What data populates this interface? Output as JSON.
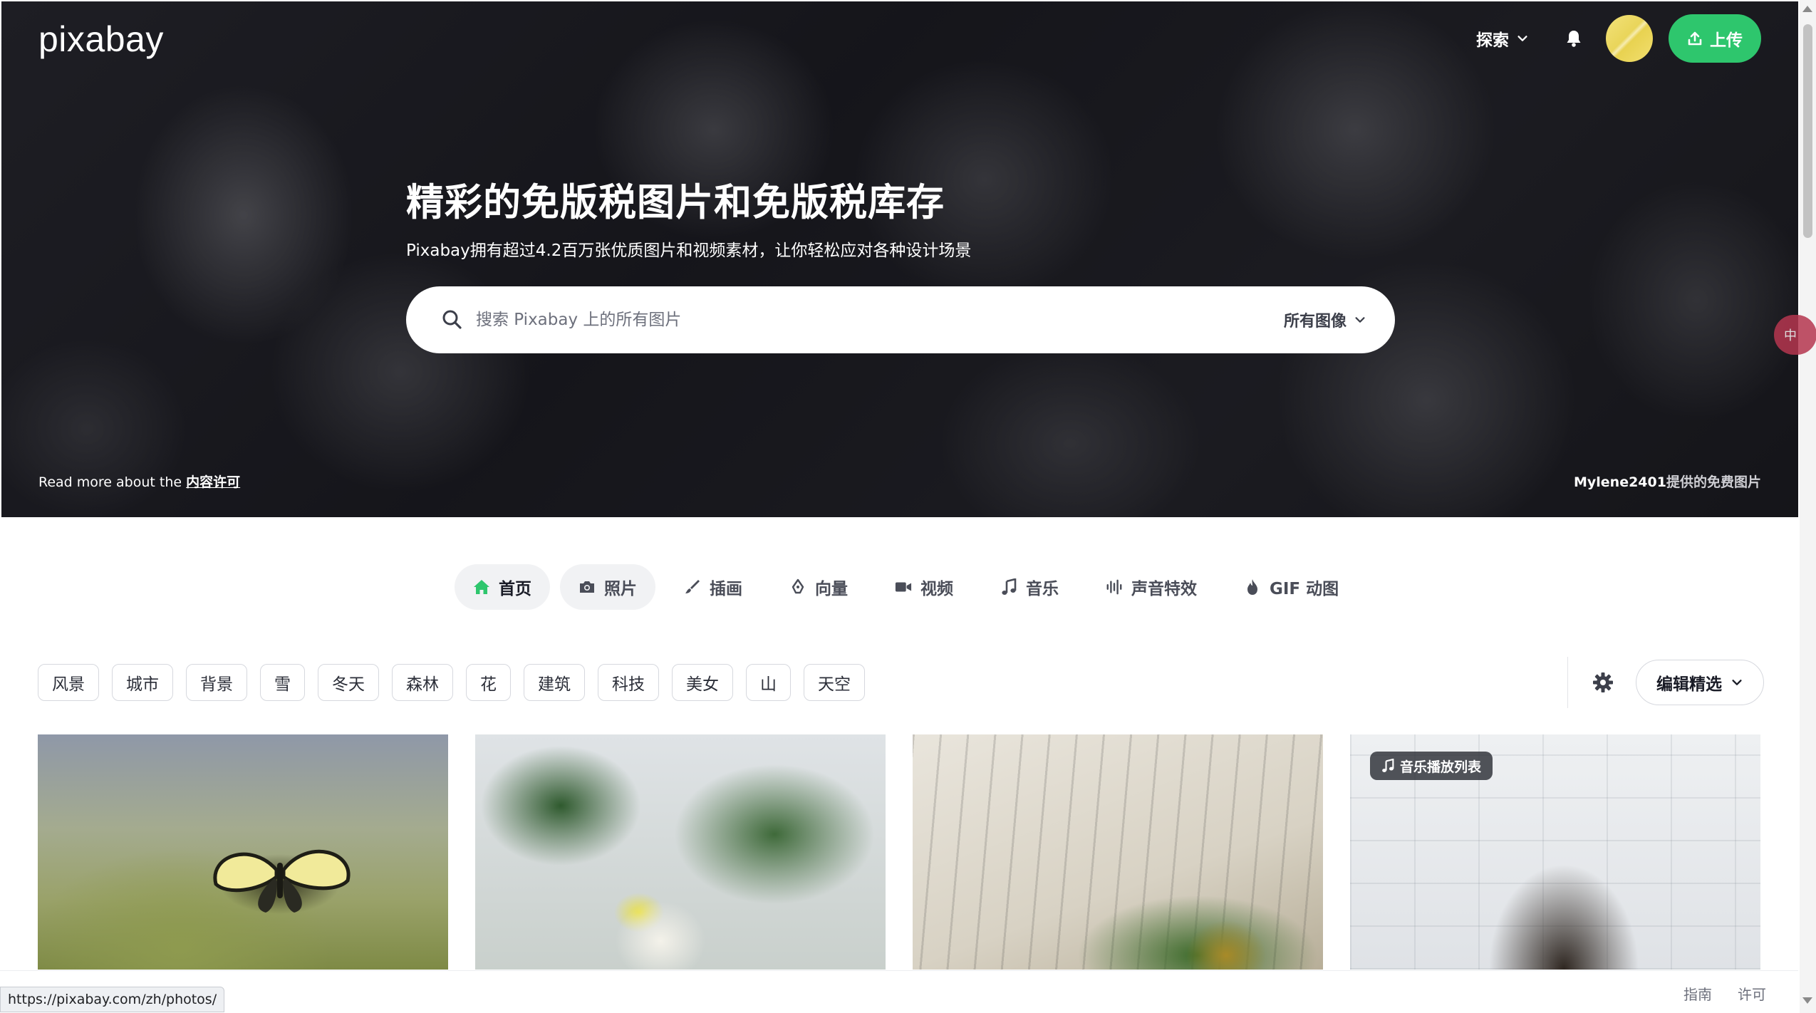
{
  "header": {
    "logo": "pixabay",
    "explore_label": "探索",
    "upload_label": "上传"
  },
  "hero": {
    "title": "精彩的免版税图片和免版税库存",
    "subtitle": "Pixabay拥有超过4.2百万张优质图片和视频素材，让你轻松应对各种设计场景",
    "search": {
      "placeholder": "搜索 Pixabay 上的所有图片",
      "filter_label": "所有图像"
    },
    "license_prefix": "Read more about the",
    "license_link": "内容许可",
    "credit_author": "Mylene2401",
    "credit_suffix": "提供的免费图片",
    "side_pill_text": "中"
  },
  "categories": [
    {
      "label": "首页",
      "icon": "home-icon"
    },
    {
      "label": "照片",
      "icon": "camera-icon"
    },
    {
      "label": "插画",
      "icon": "brush-icon"
    },
    {
      "label": "向量",
      "icon": "pen-nib-icon"
    },
    {
      "label": "视频",
      "icon": "video-camera-icon"
    },
    {
      "label": "音乐",
      "icon": "music-note-icon"
    },
    {
      "label": "声音特效",
      "icon": "sound-wave-icon"
    },
    {
      "label": "GIF 动图",
      "icon": "flame-icon"
    }
  ],
  "tags": [
    "风景",
    "城市",
    "背景",
    "雪",
    "冬天",
    "森林",
    "花",
    "建筑",
    "科技",
    "美女",
    "山",
    "天空"
  ],
  "sort": {
    "label": "编辑精选"
  },
  "grid": {
    "card4_badge": "音乐播放列表"
  },
  "status_bar": {
    "url": "https://pixabay.com/zh/photos/"
  },
  "footer": {
    "guide": "指南",
    "license": "许可"
  },
  "colors": {
    "accent_green": "#2ec66d",
    "text_dark": "#191b26"
  }
}
